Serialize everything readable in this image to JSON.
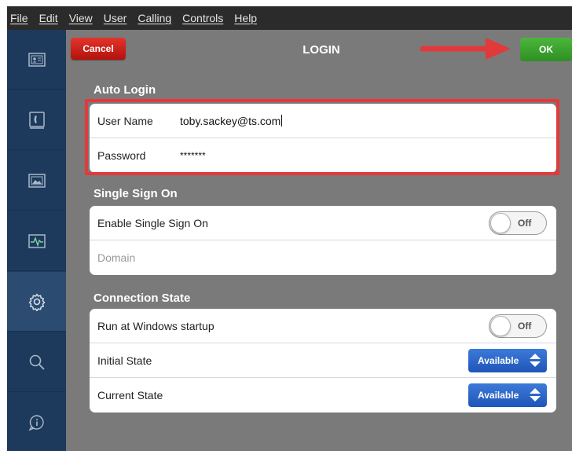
{
  "menu": [
    "File",
    "Edit",
    "View",
    "User",
    "Calling",
    "Controls",
    "Help"
  ],
  "sidebar": {
    "items": [
      {
        "icon": "contact-card-icon"
      },
      {
        "icon": "phone-icon"
      },
      {
        "icon": "picture-icon"
      },
      {
        "icon": "activity-monitor-icon"
      },
      {
        "icon": "gear-icon",
        "active": true
      },
      {
        "icon": "search-icon"
      },
      {
        "icon": "info-icon"
      }
    ]
  },
  "header": {
    "cancel_label": "Cancel",
    "title": "LOGIN",
    "ok_label": "OK"
  },
  "auto_login": {
    "title": "Auto Login",
    "user_name_label": "User Name",
    "user_name_value": "toby.sackey@ts.com",
    "password_label": "Password",
    "password_value": "*******"
  },
  "sso": {
    "title": "Single Sign On",
    "enable_label": "Enable Single Sign On",
    "enable_toggle": "Off",
    "domain_placeholder": "Domain"
  },
  "connection": {
    "title": "Connection State",
    "startup_label": "Run at Windows startup",
    "startup_toggle": "Off",
    "initial_label": "Initial State",
    "initial_value": "Available",
    "current_label": "Current State",
    "current_value": "Available"
  },
  "colors": {
    "sidebar": "#1d3a5c",
    "panel": "#7a7a7a",
    "cancel": "#c8201a",
    "ok": "#3da32f",
    "select": "#2b66c8",
    "annotation": "#e23a3a"
  }
}
